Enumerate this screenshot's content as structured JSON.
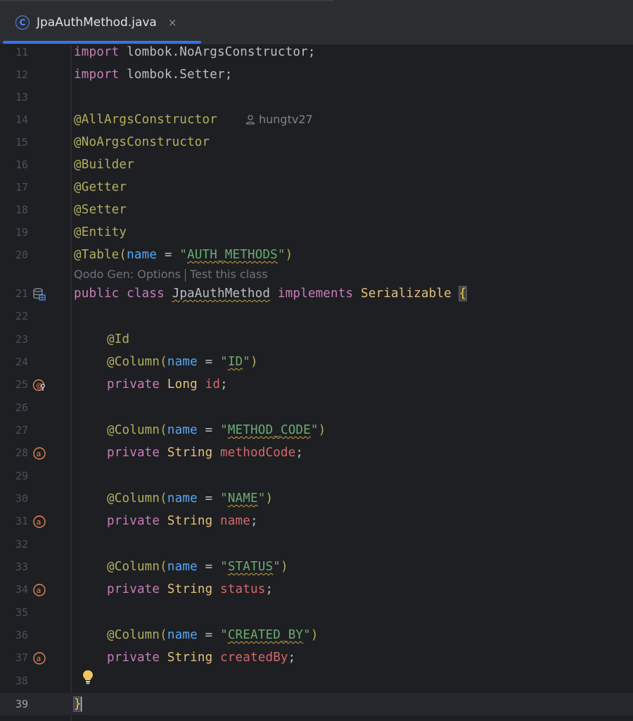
{
  "tab": {
    "title": "JpaAuthMethod.java",
    "icon": "class-c-icon",
    "icon_letter": "C",
    "close": "×"
  },
  "author": "hungtv27",
  "inlay": {
    "options": "Qodo Gen: Options",
    "test": "Test this class"
  },
  "line_numbers": [
    "11",
    "12",
    "13",
    "14",
    "15",
    "16",
    "17",
    "18",
    "19",
    "20",
    "21",
    "22",
    "23",
    "24",
    "25",
    "26",
    "27",
    "28",
    "29",
    "30",
    "31",
    "32",
    "33",
    "34",
    "35",
    "36",
    "37",
    "38",
    "39"
  ],
  "code": {
    "l11_kw": "import",
    "l11_rest": " lombok.NoArgsConstructor;",
    "l12_kw": "import",
    "l12_rest": " lombok.Setter;",
    "l14": "@AllArgsConstructor",
    "l15": "@NoArgsConstructor",
    "l16": "@Builder",
    "l17": "@Getter",
    "l18": "@Setter",
    "l19": "@Entity",
    "l20_ann": "@Table(",
    "l20_param": "name",
    "l20_eq": " = ",
    "l20_str_q1": "\"",
    "l20_str": "AUTH_METHODS",
    "l20_str_q2": "\"",
    "l20_close": ")",
    "l21_kw1": "public class ",
    "l21_cls": "JpaAuthMethod",
    "l21_kw2": " implements ",
    "l21_iface": "Serializable ",
    "l21_brace": "{",
    "l23": "@Id",
    "col_ann": "@Column(",
    "col_param": "name",
    "col_eq": " = ",
    "col_close": ")",
    "l24_str": "ID",
    "l25_kw": "private ",
    "l25_type": "Long ",
    "l25_name": "id",
    "semi": ";",
    "l27_str": "METHOD_CODE",
    "l28_kw": "private ",
    "l28_type": "String ",
    "l28_name": "methodCode",
    "l30_str": "NAME",
    "l31_kw": "private ",
    "l31_type": "String ",
    "l31_name": "name",
    "l33_str": "STATUS",
    "l34_kw": "private ",
    "l34_type": "String ",
    "l34_name": "status",
    "l36_str": "CREATED_BY",
    "l37_kw": "private ",
    "l37_type": "String ",
    "l37_name": "createdBy",
    "l39_brace": "}",
    "quote": "\""
  },
  "colors": {
    "accent": "#3574f0",
    "keyword": "#cf8e6d",
    "annotation": "#b3ae60",
    "string": "#6aab73",
    "field": "#d5676c"
  }
}
